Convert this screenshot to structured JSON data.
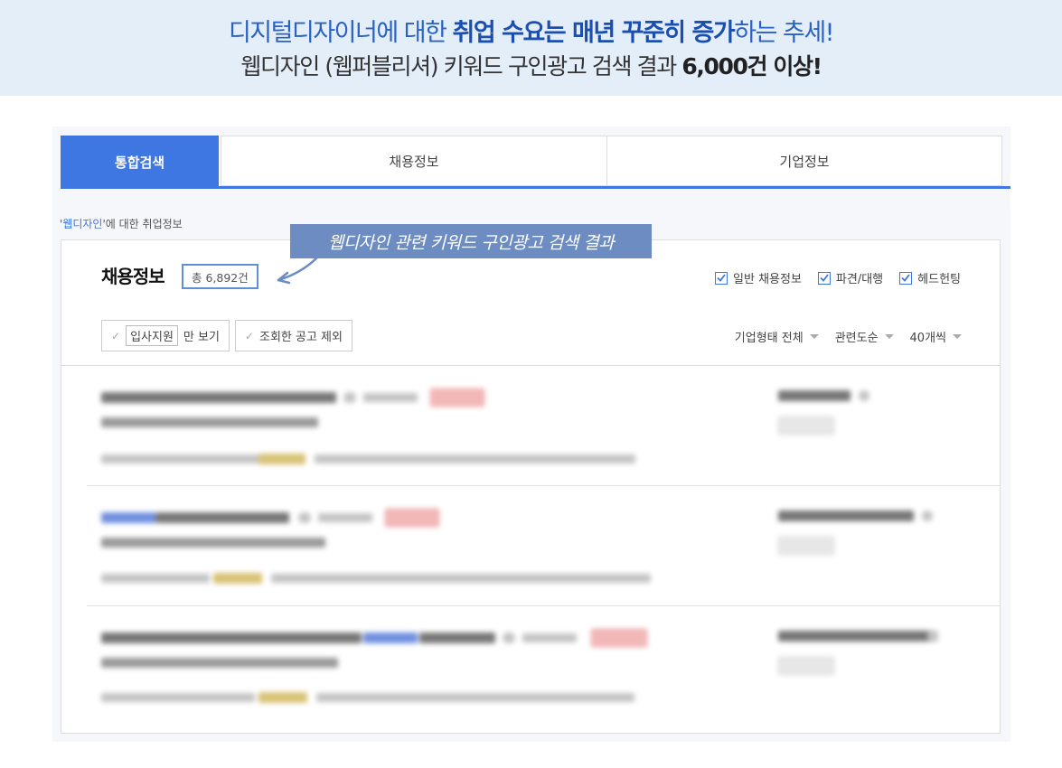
{
  "banner": {
    "line1": [
      {
        "text": "디지털디자이너에 대한 ",
        "bold": false
      },
      {
        "text": "취업 수요는 매년 꾸준히 증가",
        "bold": true
      },
      {
        "text": "하는 추세!",
        "bold": false
      }
    ],
    "line2": [
      {
        "text": "웹디자인 (웹퍼블리셔) 키워드 구인광고 검색 결과 ",
        "bold": false
      },
      {
        "text": "6,000건 이상!",
        "bold": true
      }
    ]
  },
  "tabs": {
    "integrated": "통합검색",
    "jobs": "채용정보",
    "company": "기업정보"
  },
  "about": {
    "open_quote": "'",
    "keyword": "웹디자인",
    "suffix": "'에 대한 취업정보"
  },
  "card": {
    "title": "채용정보",
    "count": "총 6,892건",
    "annotation": "웹디자인 관련 키워드 구인광고 검색 결과",
    "filters": [
      "일반 채용정보",
      "파견/대행",
      "헤드헌팅"
    ],
    "option_apply_box": "입사지원",
    "option_apply_suffix": "만 보기",
    "option_exclude": "조회한 공고 제외",
    "sorts": [
      "기업형태 전체",
      "관련도순",
      "40개씩"
    ]
  },
  "colors": {
    "accent": "#3f77e2",
    "banner_bg": "#e4eef9",
    "annotation_bg": "#6d8cc1"
  }
}
